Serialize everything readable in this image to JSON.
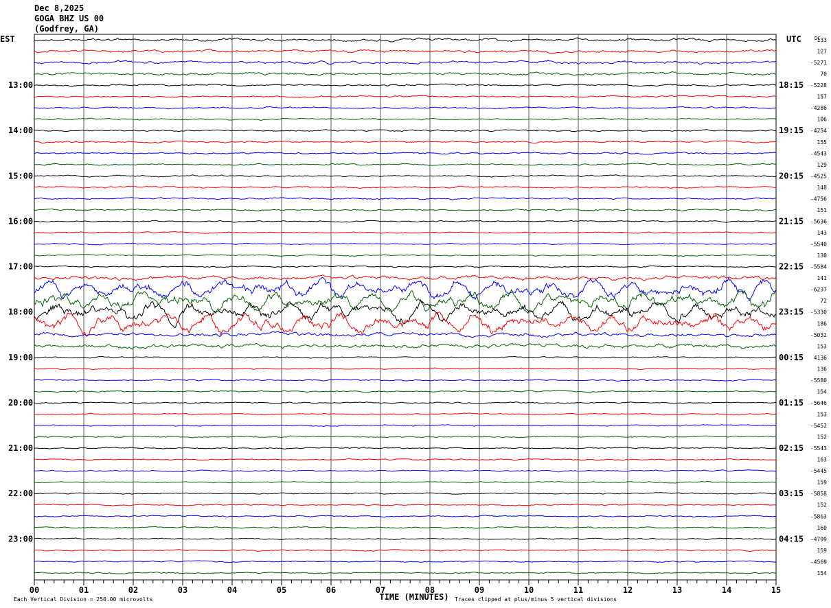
{
  "header": {
    "date": "Dec 8,2025",
    "station": "GOGA BHZ US 00",
    "location": "(Godfrey, GA)"
  },
  "chart_data": {
    "type": "line",
    "title": "",
    "left_timezone": "EST",
    "right_timezone": "UTC",
    "dc_label": "DC",
    "xlabel": "TIME (MINUTES)",
    "xlim": [
      0,
      15
    ],
    "x_ticks": [
      "00",
      "01",
      "02",
      "03",
      "04",
      "05",
      "06",
      "07",
      "08",
      "09",
      "10",
      "11",
      "12",
      "13",
      "14",
      "15"
    ],
    "left_hour_labels": [
      "13:00",
      "14:00",
      "15:00",
      "16:00",
      "17:00",
      "18:00",
      "19:00",
      "20:00",
      "21:00",
      "22:00",
      "23:00"
    ],
    "right_hour_labels": [
      "18:15",
      "19:15",
      "20:15",
      "21:15",
      "22:15",
      "23:15",
      "00:15",
      "01:15",
      "02:15",
      "03:15",
      "04:15"
    ],
    "trace_colors": [
      "#000000",
      "#ff0000",
      "#0000ff",
      "#006400"
    ],
    "trace_count": 48,
    "minutes_per_trace": 15,
    "dc_offsets": [
      133,
      127,
      -5271,
      70,
      -5228,
      157,
      -4286,
      106,
      -4254,
      155,
      -4543,
      129,
      -4525,
      148,
      -4756,
      151,
      -5636,
      143,
      -5540,
      130,
      -5584,
      141,
      -6237,
      72,
      -5330,
      186,
      -5032,
      153,
      4136,
      136,
      -5580,
      154,
      -5646,
      153,
      -5452,
      152,
      -5543,
      163,
      -5445,
      159,
      -5858,
      152,
      -5863,
      160,
      -4799,
      159,
      -4569,
      154
    ],
    "grid": true
  },
  "footer": {
    "scale_note": "Each Vertical Division =  250.00 microvolts",
    "clip_note": "Traces clipped at plus/minus 5 vertical divisions"
  }
}
